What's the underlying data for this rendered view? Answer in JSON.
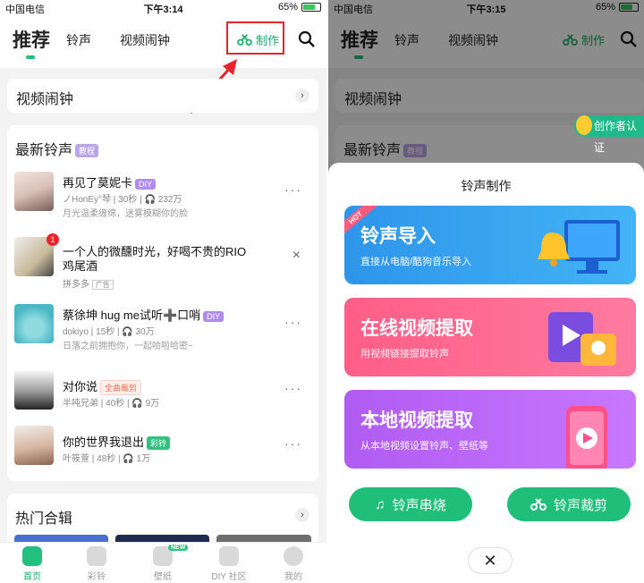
{
  "left": {
    "status": {
      "carrier": "中国电信",
      "time": "下午3:14",
      "battery": "65%"
    },
    "tabs": [
      "推荐",
      "铃声",
      "视频闹钟"
    ],
    "make_label": "制作",
    "video_alarm_label": "视频闹钟",
    "latest_title": "最新铃声",
    "tutorial_badge": "教程",
    "songs": [
      {
        "title": "再见了莫妮卡",
        "badge": "DIY",
        "author": "ノHonEy°琴",
        "duration": "30秒",
        "plays": "232万",
        "desc": "月光温柔缠绵，迷雾模糊你的脸",
        "more": "···"
      },
      {
        "title": "一个人的微醺时光，好喝不贵的RIO",
        "title2": "鸡尾酒",
        "author": "拼多多",
        "ad": "广告",
        "count": "1",
        "more": "×"
      },
      {
        "title": "蔡徐坤 hug me试听➕口哨",
        "badge": "DIY",
        "author": "dokiyo",
        "duration": "15秒",
        "plays": "30万",
        "desc": "日落之前拥抱你，一起哈啦哈密~",
        "more": "···"
      },
      {
        "title": "对你说",
        "badge": "全曲裁剪",
        "author": "半吨兄弟",
        "duration": "40秒",
        "plays": "9万",
        "more": "···"
      },
      {
        "title": "你的世界我退出",
        "badge": "彩铃",
        "author": "叶筱萱",
        "duration": "48秒",
        "plays": "1万",
        "more": "···"
      }
    ],
    "hot_title": "热门合辑",
    "bottom_nav": [
      "首页",
      "彩铃",
      "壁纸",
      "DIY 社区",
      "我的"
    ],
    "new_tag": "NEW"
  },
  "right": {
    "status": {
      "carrier": "中国电信",
      "time": "下午3:15",
      "battery": "65%"
    },
    "tabs": [
      "推荐",
      "铃声",
      "视频闹钟"
    ],
    "make_label": "制作",
    "video_alarm_label": "视频闹钟",
    "latest_title": "最新铃声",
    "tutorial_badge": "教程",
    "creator_label": "创作者认证",
    "sheet_title": "铃声制作",
    "features": [
      {
        "title": "铃声导入",
        "subtitle": "直接从电脑/酷狗音乐导入",
        "tag": "HOT",
        "color": "#2f9bea"
      },
      {
        "title": "在线视频提取",
        "subtitle": "用视频链接提取铃声",
        "color": "#ff5f8f"
      },
      {
        "title": "本地视频提取",
        "subtitle": "从本地视频设置铃声、壁纸等",
        "color": "#b060f2"
      }
    ],
    "pills": [
      "铃声串烧",
      "铃声裁剪"
    ],
    "close": "✕"
  }
}
